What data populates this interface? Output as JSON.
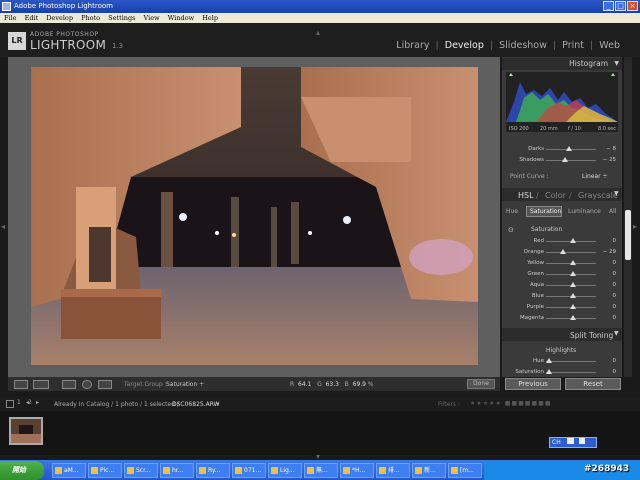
{
  "window": {
    "title": "Adobe Photoshop Lightroom"
  },
  "menu": [
    "File",
    "Edit",
    "Develop",
    "Photo",
    "Settings",
    "View",
    "Window",
    "Help"
  ],
  "header": {
    "logo": "LR",
    "brand_top": "ADOBE PHOTOSHOP",
    "brand_main": "LIGHTROOM",
    "version": "1.3",
    "modules": [
      "Library",
      "Develop",
      "Slideshow",
      "Print",
      "Web"
    ],
    "active_module": "Develop"
  },
  "panel": {
    "histogram_title": "Histogram",
    "histo_info": {
      "iso": "ISO 200",
      "focal": "20 mm",
      "aperture": "f / 10",
      "shutter": "8.0 sec"
    },
    "tone": [
      {
        "label": "Darks",
        "value": "− 8"
      },
      {
        "label": "Shadows",
        "value": "− 25"
      }
    ],
    "point_curve_label": "Point Curve :",
    "point_curve_value": "Linear ÷",
    "hsl_tabs": [
      "HSL",
      "/",
      "Color",
      "/",
      "Grayscale"
    ],
    "sub_tabs": [
      "Hue",
      "Saturation",
      "Luminance",
      "All"
    ],
    "active_sub_tab": "Saturation",
    "saturation_title": "Saturation",
    "saturation": [
      {
        "label": "Red",
        "value": "0"
      },
      {
        "label": "Orange",
        "value": "− 29"
      },
      {
        "label": "Yellow",
        "value": "0"
      },
      {
        "label": "Green",
        "value": "0"
      },
      {
        "label": "Aqua",
        "value": "0"
      },
      {
        "label": "Blue",
        "value": "0"
      },
      {
        "label": "Purple",
        "value": "0"
      },
      {
        "label": "Magenta",
        "value": "0"
      }
    ],
    "split_toning_title": "Split Toning",
    "highlights_title": "Highlights",
    "split": [
      {
        "label": "Hue",
        "value": "0"
      },
      {
        "label": "Saturation",
        "value": "0"
      }
    ]
  },
  "toolbar": {
    "target_group_label": "Target Group :",
    "target_group_value": "Saturation ÷",
    "r_label": "R",
    "r_value": "64.1",
    "g_label": "G",
    "g_value": "63.3",
    "b_label": "B",
    "b_value": "69.9",
    "pct": "%",
    "done_label": "Done",
    "previous_label": "Previous",
    "reset_label": "Reset"
  },
  "filmstrip": {
    "page1": "1",
    "page2": "2",
    "catalog_info": "Already In Catalog / 1 photo / 1 selected /",
    "filename": "DSC06825.ARW",
    "filters_label": "Filters :"
  },
  "ime": {
    "label": "CH"
  },
  "taskbar": {
    "start_label": "開始",
    "tasks": [
      "aM...",
      "Pic...",
      "Scr...",
      "hr...",
      "Ry...",
      "071...",
      "Lig...",
      "無...",
      "*H...",
      "排...",
      "新...",
      "[m..."
    ]
  },
  "watermark": "#268943",
  "colors": {
    "accent": "#2356c9",
    "panel": "#3a3a3a",
    "highlight": "#5a7bb0"
  }
}
